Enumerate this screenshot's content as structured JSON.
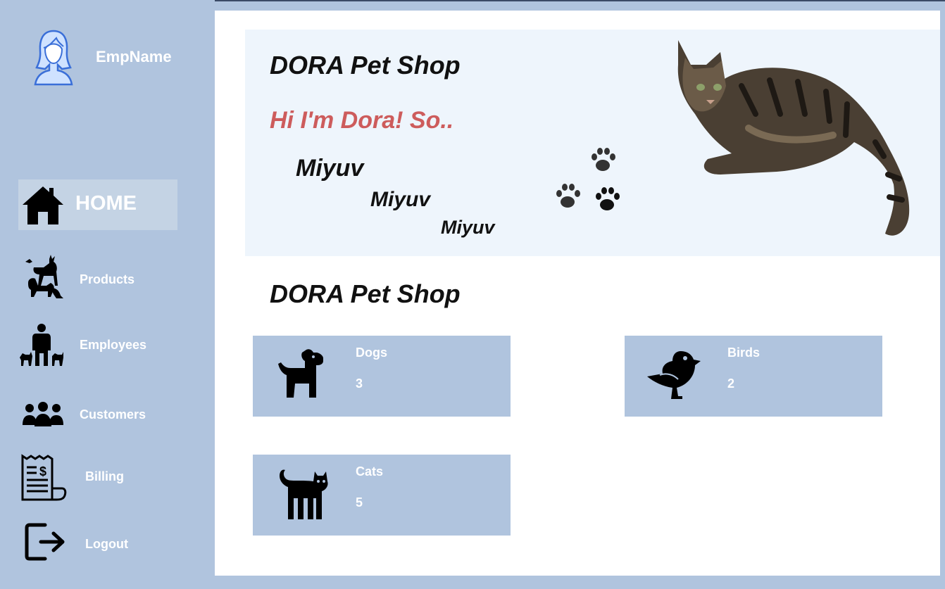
{
  "user": {
    "name": "EmpName"
  },
  "nav": {
    "home": "HOME",
    "products": "Products",
    "employees": "Employees",
    "customers": "Customers",
    "billing": "Billing",
    "logout": "Logout"
  },
  "banner": {
    "title": "DORA Pet Shop",
    "greeting": "Hi I'm Dora! So..",
    "meows": [
      "Miyuv",
      "Miyuv",
      "Miyuv"
    ]
  },
  "section": {
    "title": "DORA Pet Shop"
  },
  "cards": {
    "dogs": {
      "label": "Dogs",
      "count": "3",
      "icon": "dog-icon"
    },
    "birds": {
      "label": "Birds",
      "count": "2",
      "icon": "bird-icon"
    },
    "cats": {
      "label": "Cats",
      "count": "5",
      "icon": "cat-icon"
    }
  },
  "colors": {
    "sidebar": "#b0c4de",
    "home_highlight": "#c4d3e4",
    "banner_bg": "#eef5fc",
    "greeting": "#cd5c5c"
  }
}
